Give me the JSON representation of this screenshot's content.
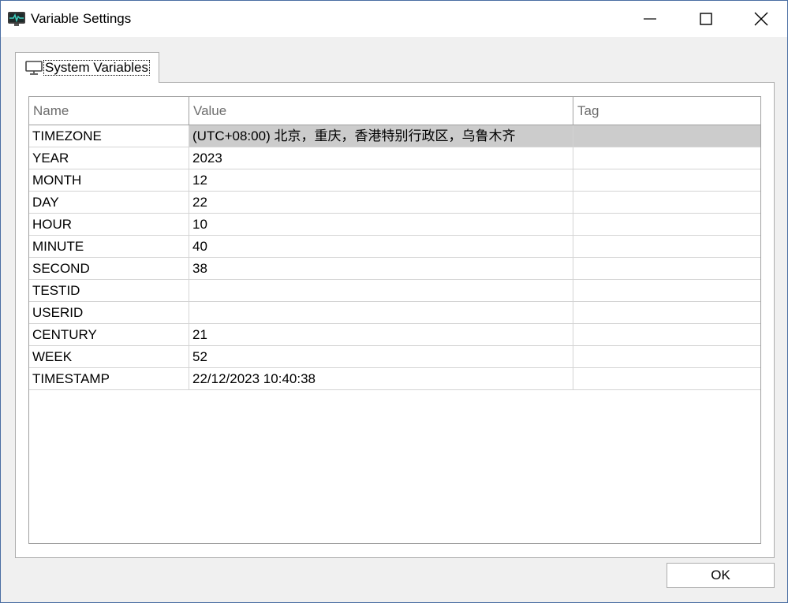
{
  "window": {
    "title": "Variable Settings",
    "app_icon": "heart-monitor-icon",
    "controls": {
      "minimize_icon": "minimize-icon",
      "maximize_icon": "maximize-icon",
      "close_icon": "close-icon"
    }
  },
  "tabs": [
    {
      "label": "System Variables",
      "icon": "monitor-icon",
      "selected": true
    }
  ],
  "table": {
    "columns": [
      "Name",
      "Value",
      "Tag"
    ],
    "rows": [
      {
        "name": "TIMEZONE",
        "value": "(UTC+08:00) 北京，重庆，香港特别行政区，乌鲁木齐",
        "tag": "",
        "selected": true
      },
      {
        "name": "YEAR",
        "value": "2023",
        "tag": ""
      },
      {
        "name": "MONTH",
        "value": "12",
        "tag": ""
      },
      {
        "name": "DAY",
        "value": "22",
        "tag": ""
      },
      {
        "name": "HOUR",
        "value": "10",
        "tag": ""
      },
      {
        "name": "MINUTE",
        "value": "40",
        "tag": ""
      },
      {
        "name": "SECOND",
        "value": "38",
        "tag": ""
      },
      {
        "name": "TESTID",
        "value": "",
        "tag": ""
      },
      {
        "name": "USERID",
        "value": "",
        "tag": ""
      },
      {
        "name": "CENTURY",
        "value": "21",
        "tag": ""
      },
      {
        "name": "WEEK",
        "value": "52",
        "tag": ""
      },
      {
        "name": "TIMESTAMP",
        "value": "22/12/2023 10:40:38",
        "tag": ""
      }
    ]
  },
  "footer": {
    "ok_label": "OK"
  },
  "colors": {
    "selected_row": "#cccccc",
    "window_border": "#4a6da3",
    "header_text": "#6d6d6d"
  }
}
